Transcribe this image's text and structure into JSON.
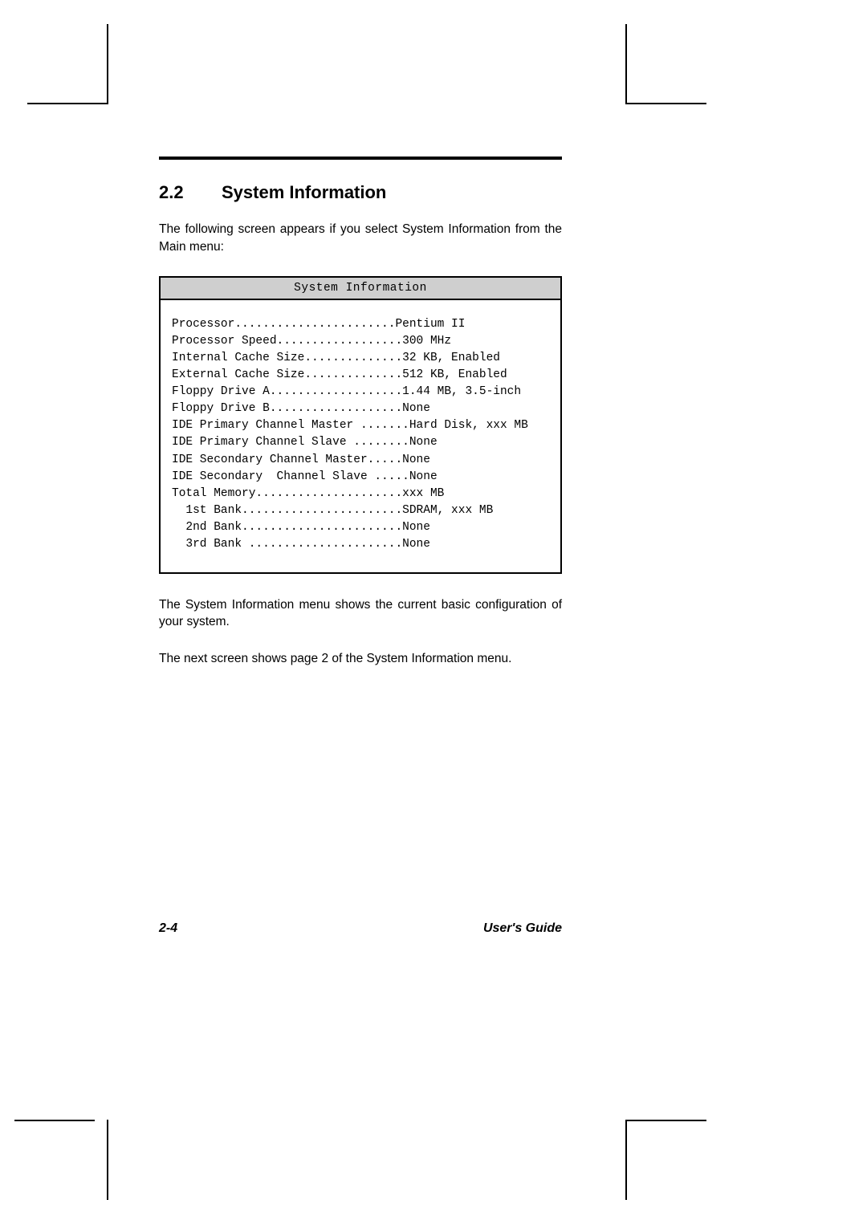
{
  "heading": {
    "number": "2.2",
    "title": "System Information"
  },
  "para1": "The following screen appears if you select System Information from the Main menu:",
  "screen": {
    "title": "System Information",
    "rows": [
      {
        "label": "Processor",
        "dots": ".......................",
        "value": "Pentium II",
        "indent": ""
      },
      {
        "label": "Processor Speed",
        "dots": "..................",
        "value": "300 MHz",
        "indent": ""
      },
      {
        "label": "Internal Cache Size",
        "dots": "..............",
        "value": "32 KB, Enabled",
        "indent": ""
      },
      {
        "label": "External Cache Size",
        "dots": "..............",
        "value": "512 KB, Enabled",
        "indent": ""
      },
      {
        "label": "Floppy Drive A",
        "dots": "...................",
        "value": "1.44 MB, 3.5-inch",
        "indent": ""
      },
      {
        "label": "Floppy Drive B",
        "dots": "...................",
        "value": "None",
        "indent": ""
      },
      {
        "label": "IDE Primary Channel Master ",
        "dots": ".......",
        "value": "Hard Disk, xxx MB",
        "indent": ""
      },
      {
        "label": "IDE Primary Channel Slave ",
        "dots": "........",
        "value": "None",
        "indent": ""
      },
      {
        "label": "IDE Secondary Channel Master",
        "dots": ".....",
        "value": "None",
        "indent": ""
      },
      {
        "label": "IDE Secondary  Channel Slave ",
        "dots": ".....",
        "value": "None",
        "indent": ""
      },
      {
        "label": "Total Memory",
        "dots": ".....................",
        "value": "xxx MB",
        "indent": ""
      },
      {
        "label": "1st Bank",
        "dots": ".......................",
        "value": "SDRAM, xxx MB",
        "indent": "  "
      },
      {
        "label": "2nd Bank",
        "dots": ".......................",
        "value": "None",
        "indent": "  "
      },
      {
        "label": "3rd Bank ",
        "dots": "......................",
        "value": "None",
        "indent": "  "
      }
    ]
  },
  "para2": "The System Information menu shows the current basic configuration of your system.",
  "para3": "The next screen shows page 2 of the System Information menu.",
  "footer": {
    "page": "2-4",
    "book": "User's Guide"
  }
}
